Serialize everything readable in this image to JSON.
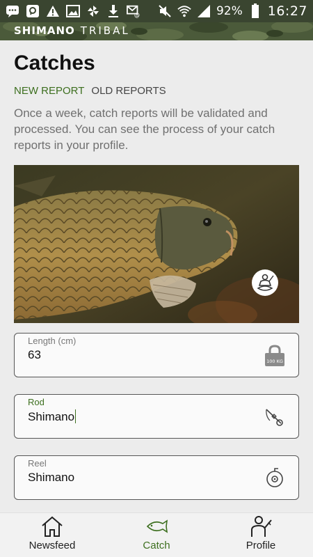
{
  "status_bar": {
    "battery_percent": "92%",
    "time": "16:27",
    "icons": [
      "chat-icon",
      "message-icon",
      "warning-icon",
      "gallery-icon",
      "pinwheel-icon",
      "download-icon",
      "email-icon",
      "mute-icon",
      "wifi-icon",
      "signal-icon",
      "battery-icon"
    ]
  },
  "brand": {
    "name": "SHIMANO",
    "sub": "TRIBAL"
  },
  "page": {
    "title": "Catches",
    "tabs": [
      {
        "label": "NEW REPORT",
        "active": true
      },
      {
        "label": "OLD REPORTS",
        "active": false
      }
    ],
    "description": "Once a week, catch reports will be validated and processed. You can see the process of your catch reports in your profile."
  },
  "photo": {
    "badge_icon": "fisherman-icon"
  },
  "fields": [
    {
      "label": "Length (cm)",
      "value": "63",
      "icon": "weight-lock-icon",
      "icon_text": "100 KG"
    },
    {
      "label": "Rod",
      "value": "Shimano",
      "icon": "rod-icon"
    },
    {
      "label": "Reel",
      "value": "Shimano",
      "icon": "reel-icon"
    }
  ],
  "bottom_nav": [
    {
      "label": "Newsfeed",
      "icon": "home-icon"
    },
    {
      "label": "Catch",
      "icon": "fish-icon",
      "active": true
    },
    {
      "label": "Profile",
      "icon": "fisher-profile-icon"
    }
  ],
  "colors": {
    "accent": "#3d6f1f",
    "status_bar": "#3a4530"
  }
}
